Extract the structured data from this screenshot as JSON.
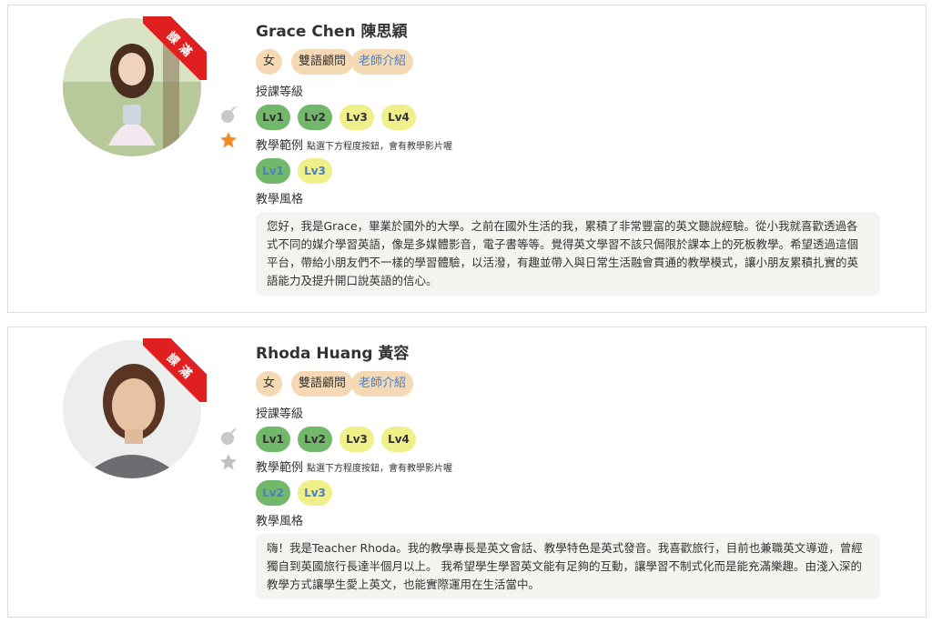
{
  "teachers": [
    {
      "ribbon": "課滿",
      "name": "Grace Chen 陳思穎",
      "gender": "女",
      "role": "雙語顧問",
      "intro": "老師介紹",
      "level_label": "授課等級",
      "levels": [
        "Lv1",
        "Lv2",
        "Lv3",
        "Lv4"
      ],
      "example_label": "教學範例",
      "example_hint": "點選下方程度按鈕，會有教學影片喔",
      "examples": [
        "Lv1",
        "Lv3"
      ],
      "style_label": "教學風格",
      "style_text": "您好，我是Grace，畢業於國外的大學。之前在國外生活的我，累積了非常豐富的英文聽說經驗。從小我就喜歡透過各式不同的媒介學習英語，像是多媒體影音，電子書等等。覺得英文學習不該只侷限於課本上的死板教學。希望透過這個平台，帶給小朋友們不一樣的學習體驗，以活潑，有趣並帶入與日常生活融會貫通的教學模式，讓小朋友累積扎實的英語能力及提升開口說英語的信心。",
      "favorite": true
    },
    {
      "ribbon": "課滿",
      "name": "Rhoda Huang 黃容",
      "gender": "女",
      "role": "雙語顧問",
      "intro": "老師介紹",
      "level_label": "授課等級",
      "levels": [
        "Lv1",
        "Lv2",
        "Lv3",
        "Lv4"
      ],
      "example_label": "教學範例",
      "example_hint": "點選下方程度按鈕，會有教學影片喔",
      "examples": [
        "Lv2",
        "Lv3"
      ],
      "style_label": "教學風格",
      "style_text": "嗨！我是Teacher Rhoda。我的教學專長是英文會話、教學特色是英式發音。我喜歡旅行，目前也兼職英文導遊，曾經獨自到英國旅行長達半個月以上。 我希望學生學習英文能有足夠的互動，讓學習不制式化而是能充滿樂趣。由淺入深的教學方式讓學生愛上英文，也能實際運用在生活當中。",
      "favorite": false
    }
  ],
  "colors": {
    "star_on": "#f08a24",
    "star_off": "#c0c0c0",
    "ribbon": "#e02020",
    "tag": "#f5d8b4",
    "lv_green": "#72b86a",
    "lv_yellow": "#f0f08a",
    "link": "#4a7fc2"
  }
}
